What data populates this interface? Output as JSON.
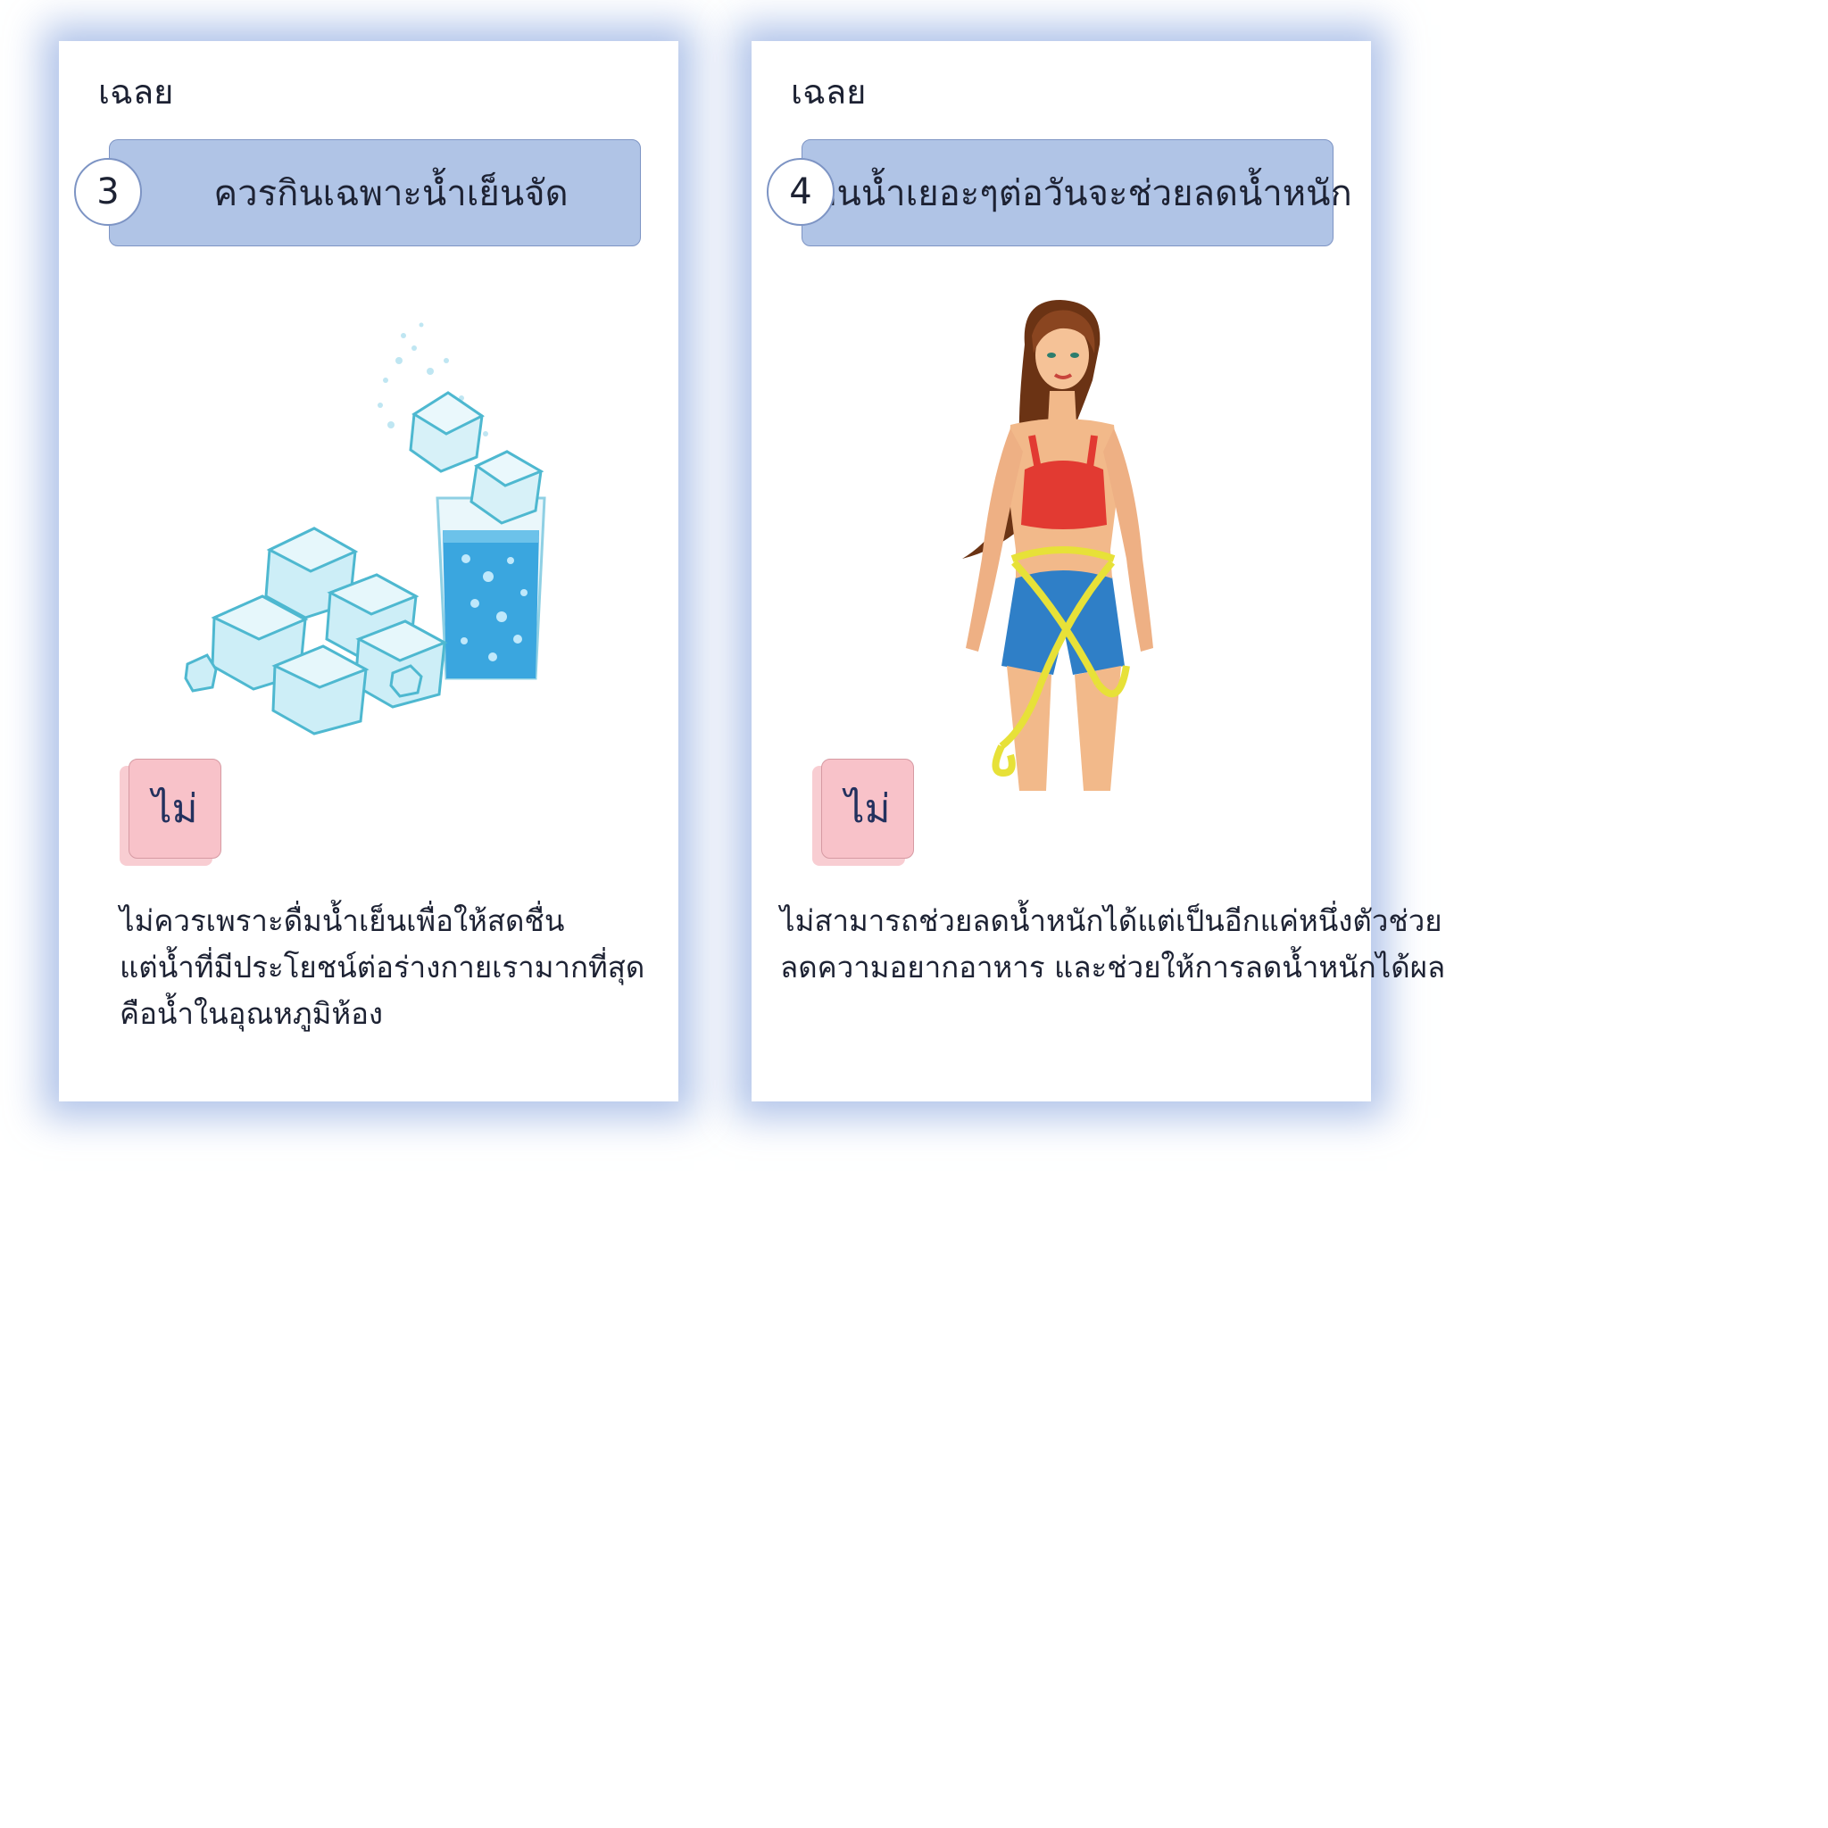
{
  "cards": [
    {
      "answer_label": "เฉลย",
      "number": "3",
      "question": "ควรกินเฉพาะน้ำเย็นจัด",
      "answer": "ไม่",
      "explanation": [
        "ไม่ควรเพราะดื่มน้ำเย็นเพื่อให้สดชื่น",
        "แต่น้ำที่มีประโยชน์ต่อร่างกายเรามากที่สุด",
        "คือน้ำในอุณหภูมิห้อง"
      ],
      "illustration": "ice-cubes-and-water-glass"
    },
    {
      "answer_label": "เฉลย",
      "number": "4",
      "question": "กินน้ำเยอะๆต่อวันจะช่วยลดน้ำหนัก",
      "answer": "ไม่",
      "explanation": [
        "ไม่สามารถช่วยลดน้ำหนักได้แต่เป็นอีกแค่หนึ่งตัวช่วย",
        "ลดความอยากอาหาร และช่วยให้การลดน้ำหนักได้ผล"
      ],
      "illustration": "woman-measuring-waist"
    }
  ],
  "colors": {
    "title_bar": "#b0c4e6",
    "badge": "#f8c2c9",
    "card_glow": "#96afe1",
    "text": "#1d2233"
  }
}
